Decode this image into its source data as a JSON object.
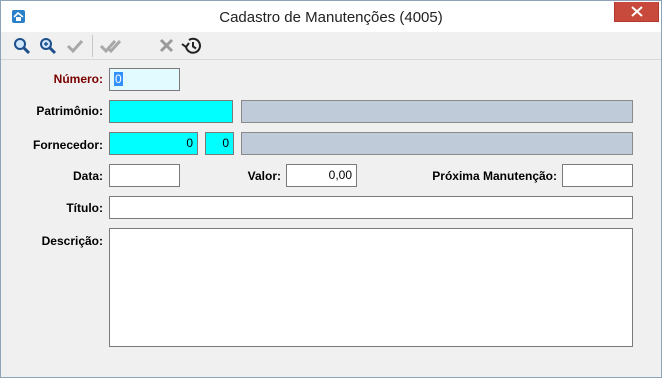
{
  "window": {
    "title": "Cadastro de Manutenções (4005)"
  },
  "toolbar": {
    "buttons": [
      {
        "name": "search-icon",
        "enabled": true
      },
      {
        "name": "search-plus-icon",
        "enabled": true
      },
      {
        "name": "check-icon",
        "enabled": false
      },
      {
        "name": "double-check-icon",
        "enabled": false
      },
      {
        "name": "cancel-icon",
        "enabled": false
      },
      {
        "name": "history-icon",
        "enabled": true
      }
    ]
  },
  "form": {
    "numero_label": "Número:",
    "numero_value": "0",
    "patrimonio_label": "Patrimônio:",
    "patrimonio_value": "",
    "patrimonio_desc": "",
    "fornecedor_label": "Fornecedor:",
    "fornecedor_value": "0",
    "fornecedor_code": "0",
    "fornecedor_desc": "",
    "data_label": "Data:",
    "data_value": "",
    "valor_label": "Valor:",
    "valor_value": "0,00",
    "proxima_label": "Próxima Manutenção:",
    "proxima_value": "",
    "titulo_label": "Título:",
    "titulo_value": "",
    "descricao_label": "Descrição:",
    "descricao_value": ""
  },
  "colors": {
    "required_label": "#7a0000",
    "key_field": "#00ffff",
    "readonly_field": "#bfcbd8",
    "close_button": "#c74a3c"
  }
}
